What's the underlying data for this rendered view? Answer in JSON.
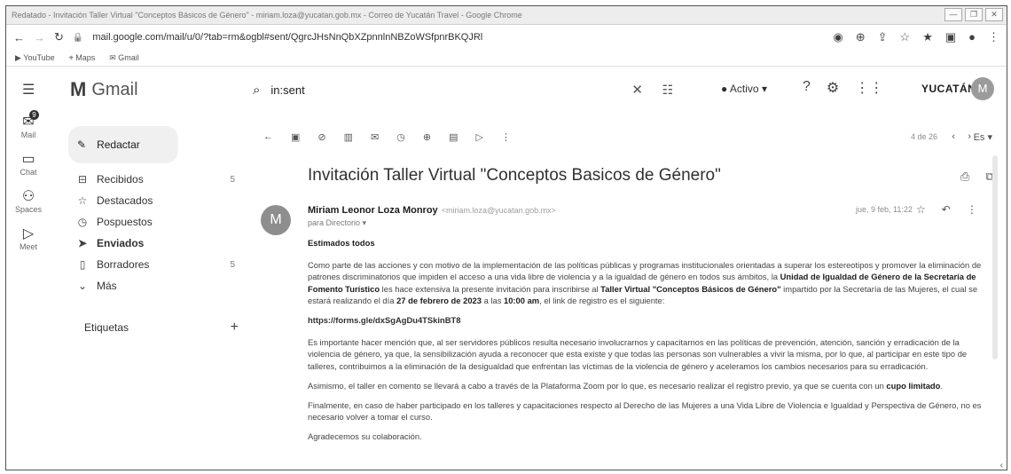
{
  "window": {
    "title": "Redatado - Invitación Taller Virtual \"Conceptos Básicos de Género\" - miriam.loza@yucatan.gob.mx - Correo de Yucatán Travel - Google Chrome",
    "controls": [
      "—",
      "❐",
      "✕"
    ]
  },
  "address_bar": {
    "url": "mail.google.com/mail/u/0/?tab=rm&ogbl#sent/QgrcJHsNnQbXZpnnlnNBZoWSfpnrBKQJRl"
  },
  "bookmarks": [
    "YouTube",
    "Maps",
    "Gmail"
  ],
  "header": {
    "app_name": "Gmail",
    "search_value": "in:sent",
    "status": "Activo",
    "brand": "YUCATÁN",
    "avatar_letter": "M"
  },
  "rail": {
    "items": [
      {
        "label": "Mail",
        "badge": "9"
      },
      {
        "label": "Chat"
      },
      {
        "label": "Spaces"
      },
      {
        "label": "Meet"
      }
    ]
  },
  "nav": {
    "compose": "Redactar",
    "items": [
      {
        "label": "Recibidos",
        "count": "5"
      },
      {
        "label": "Destacados",
        "count": ""
      },
      {
        "label": "Pospuestos",
        "count": ""
      },
      {
        "label": "Enviados",
        "count": ""
      },
      {
        "label": "Borradores",
        "count": "5"
      },
      {
        "label": "Más",
        "count": ""
      }
    ],
    "labels_heading": "Etiquetas"
  },
  "toolbar": {
    "pager": "4 de 26",
    "lang": "Es"
  },
  "email": {
    "subject": "Invitación Taller Virtual \"Conceptos Basicos de Género\"",
    "sender_name": "Miriam Leonor Loza Monroy",
    "sender_email": "<miriam.loza@yucatan.gob.mx>",
    "recipient": "para Directorio",
    "date": "jue, 9 feb, 11:22",
    "greeting": "Estimados todos",
    "p1_a": "Como parte de las acciones y con motivo de la implementación de las políticas públicas y programas institucionales orientadas a superar los estereotipos y promover la eliminación de patrones discriminatorios que impiden el acceso a una vida libre de violencia y a la igualdad de género en todos sus ámbitos, la ",
    "p1_b": "Unidad de Igualdad de Género de la Secretaría de Fomento Turístico",
    "p1_c": " les hace extensiva la presente invitación para inscribirse al ",
    "p1_d": "Taller Virtual \"Conceptos Básicos de Género\"",
    "p1_e": " impartido por la Secretaría de las Mujeres, el cual se estará realizando el día ",
    "p1_f": "27 de febrero de 2023",
    "p1_g": " a las ",
    "p1_h": "10:00 am",
    "p1_i": ", el link de registro es el siguiente:",
    "link": "https://forms.gle/dxSgAgDu4TSkinBT8",
    "p2": "Es importante hacer mención que, al ser servidores públicos resulta necesario involucrarnos y capacitarnos en las políticas de prevención, atención, sanción y erradicación de la violencia de género, ya que, la sensibilización ayuda a reconocer que esta existe y que todas las personas son vulnerables a vivir la misma, por lo que, al participar en este tipo de talleres, contribuimos a la eliminación de la desigualdad que enfrentan las víctimas de la violencia de género y aceleramos los cambios necesarios para su erradicación.",
    "p3_a": "Asimismo, el taller en comento se llevará a cabo a través de la Plataforma Zoom por lo que, es necesario realizar el registro previo, ya que se cuenta con un ",
    "p3_b": "cupo limitado",
    "p3_c": ".",
    "p4": "Finalmente, en caso de haber participado en los talleres y capacitaciones respecto al Derecho de las Mujeres a una Vida Libre de Violencia e Igualdad y Perspectiva de Género, no es necesario volver a tomar el curso.",
    "p5": "Agradecemos su colaboración."
  }
}
